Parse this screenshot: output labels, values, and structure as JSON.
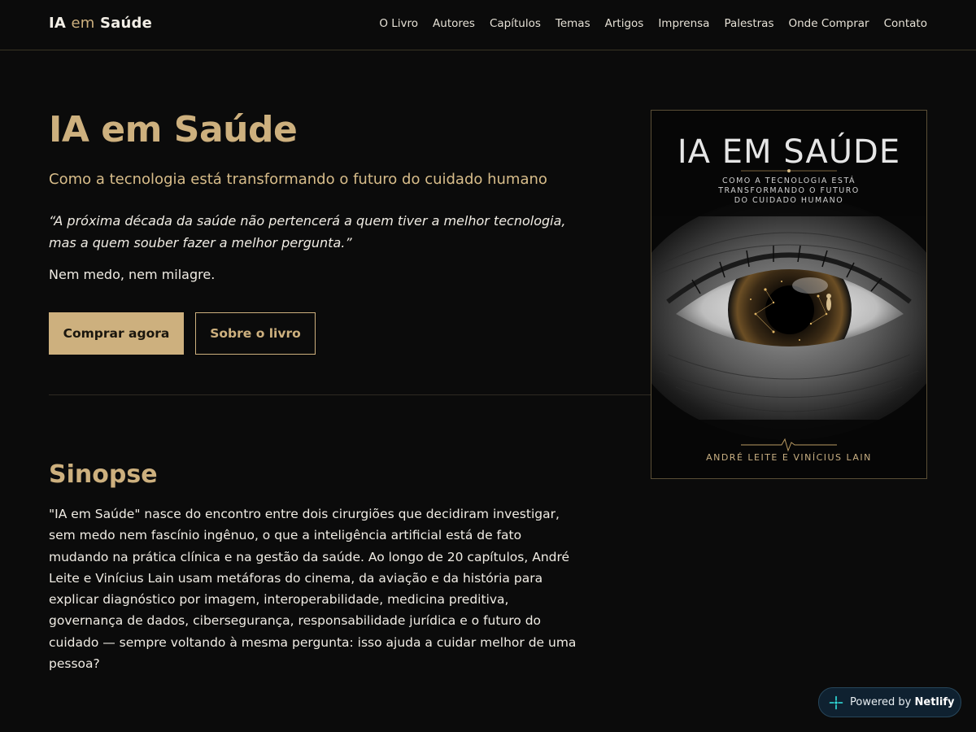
{
  "header": {
    "logo_part1": "IA",
    "logo_accent": "em",
    "logo_part2": "Saúde",
    "nav": [
      "O Livro",
      "Autores",
      "Capítulos",
      "Temas",
      "Artigos",
      "Imprensa",
      "Palestras",
      "Onde Comprar",
      "Contato"
    ]
  },
  "hero": {
    "title": "IA em Saúde",
    "subtitle": "Como a tecnologia está transformando o futuro do cuidado humano",
    "quote": "“A próxima década da saúde não pertencerá a quem tiver a melhor tecnologia, mas a quem souber fazer a melhor pergunta.”",
    "tagline": "Nem medo, nem milagre.",
    "buy_button": "Comprar agora",
    "about_button": "Sobre o livro"
  },
  "cover": {
    "title": "IA EM SAÚDE",
    "subtitle_lines": [
      "COMO A TECNOLOGIA ESTÁ",
      "TRANSFORMANDO O FUTURO",
      "DO CUIDADO HUMANO"
    ],
    "authors": "ANDRÉ LEITE E VINÍCIUS LAIN"
  },
  "synopsis": {
    "title": "Sinopse",
    "text": "\"IA em Saúde\" nasce do encontro entre dois cirurgiões que decidiram investigar, sem medo nem fascínio ingênuo, o que a inteligência artificial está de fato mudando na prática clínica e na gestão da saúde. Ao longo de 20 capítulos, André Leite e Vinícius Lain usam metáforas do cinema, da aviação e da história para explicar diagnóstico por imagem, interoperabilidade, medicina preditiva, governança de dados, cibersegurança, responsabilidade jurídica e o futuro do cuidado — sempre voltando à mesma pergunta: isso ajuda a cuidar melhor de uma pessoa?"
  },
  "badge": {
    "prefix": "Powered by",
    "brand": "Netlify",
    "icon": "netlify-icon"
  },
  "colors": {
    "background": "#0b0b0b",
    "gold": "#cdb07e",
    "text": "#f0ece4"
  }
}
